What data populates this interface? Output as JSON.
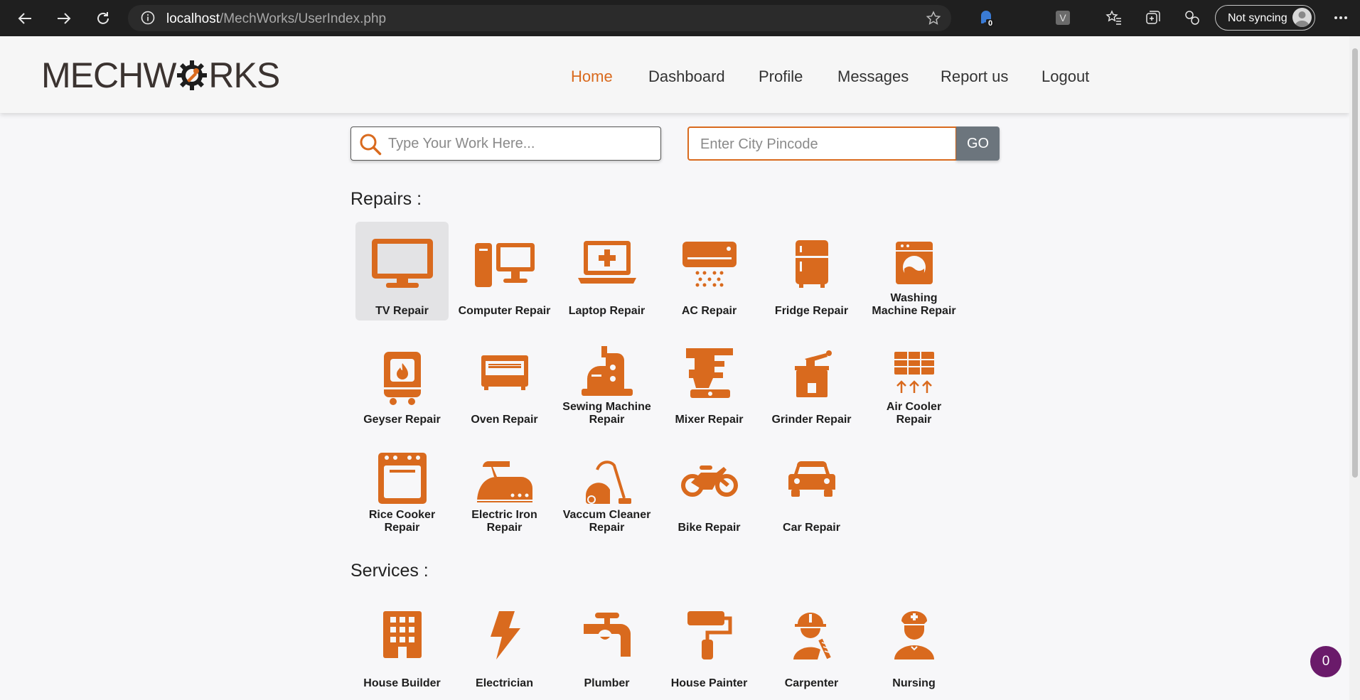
{
  "browser": {
    "url_host": "localhost",
    "url_path": "/MechWorks/UserIndex.php",
    "ext_badge": "0",
    "ext_letter": "V",
    "sync_label": "Not syncing"
  },
  "header": {
    "logo_text_left": "MECHW",
    "logo_text_right": "RKS",
    "nav": [
      "Home",
      "Dashboard",
      "Profile",
      "Messages",
      "Report us",
      "Logout"
    ],
    "active": "Home",
    "colors": {
      "accent": "#d96a1e",
      "text": "#333333"
    }
  },
  "search": {
    "work_placeholder": "Type Your Work Here...",
    "pincode_placeholder": "Enter City Pincode",
    "go_label": "GO"
  },
  "repairs": {
    "title": "Repairs :",
    "items": [
      {
        "label": "TV Repair",
        "icon": "tv-icon"
      },
      {
        "label": "Computer Repair",
        "icon": "computer-icon"
      },
      {
        "label": "Laptop Repair",
        "icon": "laptop-icon"
      },
      {
        "label": "AC Repair",
        "icon": "ac-icon"
      },
      {
        "label": "Fridge Repair",
        "icon": "fridge-icon"
      },
      {
        "label": "Washing Machine Repair",
        "icon": "washing-machine-icon"
      },
      {
        "label": "Geyser Repair",
        "icon": "geyser-icon"
      },
      {
        "label": "Oven Repair",
        "icon": "oven-icon"
      },
      {
        "label": "Sewing Machine Repair",
        "icon": "sewing-machine-icon"
      },
      {
        "label": "Mixer Repair",
        "icon": "mixer-icon"
      },
      {
        "label": "Grinder Repair",
        "icon": "grinder-icon"
      },
      {
        "label": "Air Cooler Repair",
        "icon": "air-cooler-icon"
      },
      {
        "label": "Rice Cooker Repair",
        "icon": "rice-cooker-icon"
      },
      {
        "label": "Electric Iron Repair",
        "icon": "iron-icon"
      },
      {
        "label": "Vaccum Cleaner Repair",
        "icon": "vacuum-cleaner-icon"
      },
      {
        "label": "Bike Repair",
        "icon": "bike-icon"
      },
      {
        "label": "Car Repair",
        "icon": "car-icon"
      }
    ]
  },
  "services": {
    "title": "Services :",
    "items": [
      {
        "label": "House Builder",
        "icon": "building-icon"
      },
      {
        "label": "Electrician",
        "icon": "lightning-icon"
      },
      {
        "label": "Plumber",
        "icon": "faucet-icon"
      },
      {
        "label": "House Painter",
        "icon": "paint-roller-icon"
      },
      {
        "label": "Carpenter",
        "icon": "worker-icon"
      },
      {
        "label": "Nursing",
        "icon": "nurse-icon"
      }
    ]
  },
  "chat_badge": "0"
}
